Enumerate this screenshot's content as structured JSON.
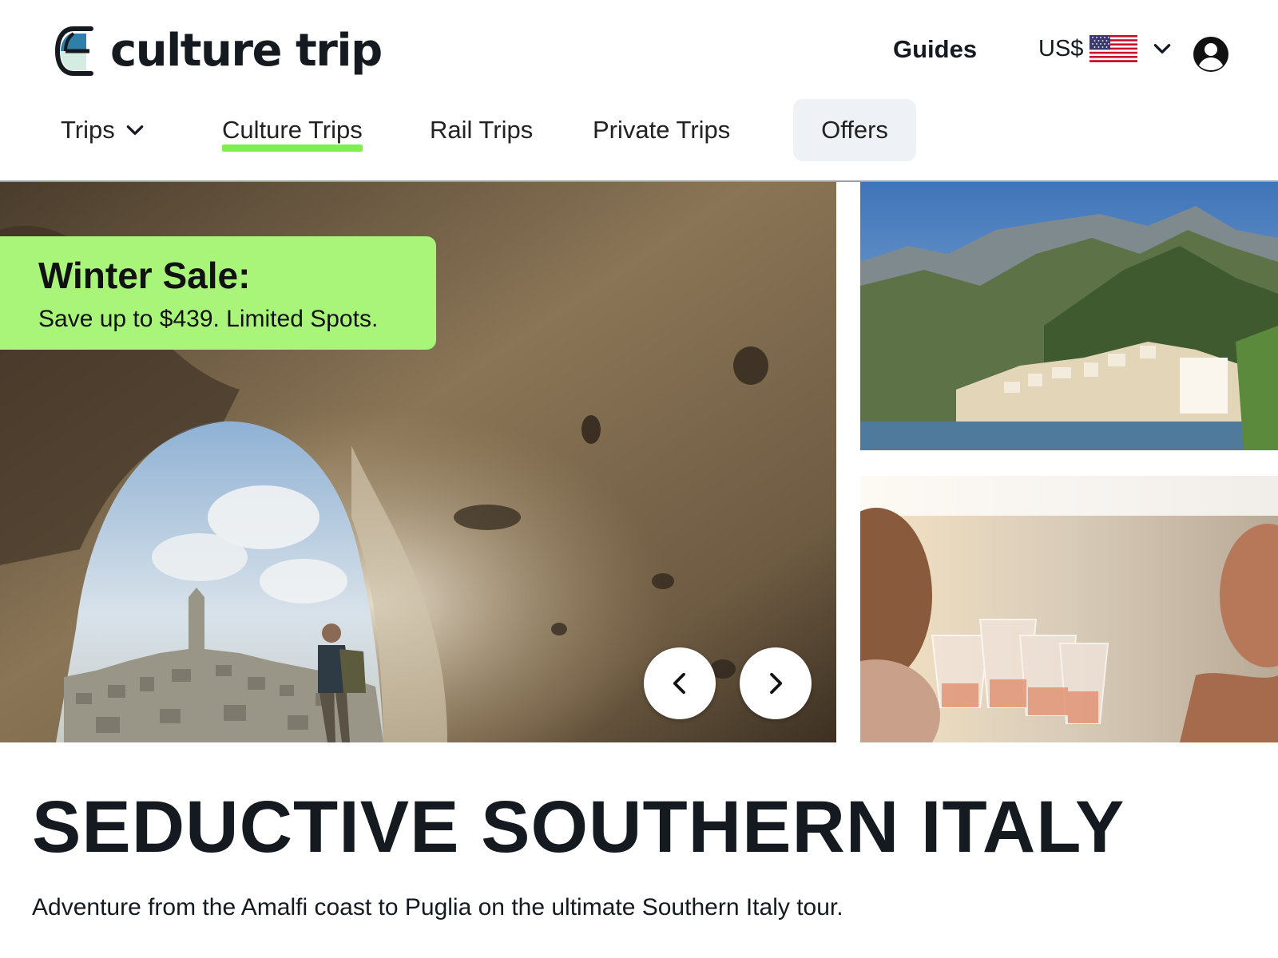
{
  "header": {
    "logo_text": "culture trip",
    "guides_label": "Guides",
    "currency_label": "US$",
    "colors": {
      "brand_green": "#7fef50",
      "text": "#141a1f"
    }
  },
  "nav": {
    "trips_label": "Trips",
    "items": [
      {
        "label": "Culture Trips",
        "active": true
      },
      {
        "label": "Rail Trips",
        "active": false
      },
      {
        "label": "Private Trips",
        "active": false
      },
      {
        "label": "Offers",
        "active": false
      }
    ]
  },
  "promo": {
    "title": "Winter Sale:",
    "subtitle": "Save up to $439. Limited Spots.",
    "background": "#a9f57a"
  },
  "hero": {
    "images": [
      "cave-arch-view-of-matera",
      "amalfi-coast-village",
      "friends-toasting-rose-wine"
    ],
    "prev_icon": "chevron-left-icon",
    "next_icon": "chevron-right-icon"
  },
  "trip": {
    "title": "SEDUCTIVE SOUTHERN ITALY",
    "description": "Adventure from the Amalfi coast to Puglia on the ultimate Southern Italy tour."
  }
}
